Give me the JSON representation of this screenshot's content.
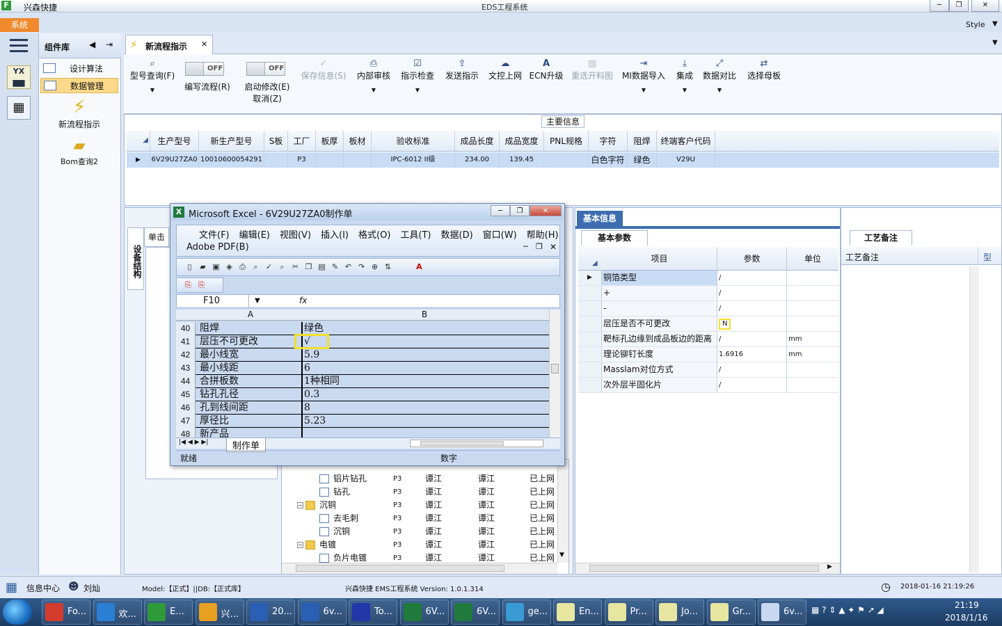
{
  "window": {
    "app_name": "兴森快捷",
    "title": "EDS工程系统",
    "style_label": "Style"
  },
  "system_menu": "系统",
  "component_library": {
    "title": "组件库",
    "items": [
      {
        "label": "设计算法"
      },
      {
        "label": "数据管理",
        "selected": true
      }
    ],
    "tools": [
      {
        "label": "新流程指示"
      },
      {
        "label": "Bom查询2"
      }
    ]
  },
  "doc_tab": {
    "label": "新流程指示"
  },
  "ribbon": {
    "buttons": [
      {
        "label": "型号查询(F)",
        "icon": "search-icon",
        "disabled": false
      },
      {
        "label": "保存信息(S)",
        "icon": "check-icon",
        "disabled": true
      },
      {
        "label": "内部审核",
        "icon": "printer-icon",
        "disabled": false
      },
      {
        "label": "指示检查",
        "icon": "checkbox-icon",
        "disabled": false
      },
      {
        "label": "发送指示",
        "icon": "upload-icon",
        "disabled": false
      },
      {
        "label": "文控上网",
        "icon": "cloud-upload-icon",
        "disabled": false
      },
      {
        "label": "ECN升级",
        "icon": "letter-a-icon",
        "disabled": false
      },
      {
        "label": "重选开料图",
        "icon": "image-icon",
        "disabled": true
      },
      {
        "label": "MI数据导入",
        "icon": "import-icon",
        "disabled": false
      },
      {
        "label": "集成",
        "icon": "download-icon",
        "disabled": false
      },
      {
        "label": "数据对比",
        "icon": "compare-icon",
        "disabled": false
      },
      {
        "label": "选择母板",
        "icon": "shuffle-icon",
        "disabled": false
      }
    ],
    "toggles": [
      {
        "state": "OFF",
        "label": "编写流程(R)"
      },
      {
        "state": "OFF",
        "label": "启动修改(E)",
        "sub_label": "取消(Z)"
      }
    ]
  },
  "main_info": {
    "title": "主要信息",
    "columns": [
      "生产型号",
      "新生产型号",
      "S板",
      "工厂",
      "板厚",
      "板材",
      "验收标准",
      "成品长度",
      "成品宽度",
      "PNL规格",
      "字符",
      "阻焊",
      "终端客户代码"
    ],
    "rows": [
      [
        "6V29U27ZA0",
        "10010600054291",
        "",
        "P3",
        "",
        "",
        "IPC-6012 II级",
        "234.00",
        "139.45",
        "",
        "白色字符",
        "绿色",
        "V29U"
      ]
    ]
  },
  "left_panel": {
    "vertical_tab": "设备结构",
    "tab_label": "单击"
  },
  "tree": {
    "rows": [
      {
        "label": "铝片钻孔",
        "level": 2,
        "type": "doc",
        "c1": "P3",
        "c2": "谭江",
        "c3": "谭江",
        "c4": "已上网"
      },
      {
        "label": "钻孔",
        "level": 2,
        "type": "doc",
        "c1": "P3",
        "c2": "谭江",
        "c3": "谭江",
        "c4": "已上网"
      },
      {
        "label": "沉铜",
        "level": 1,
        "type": "folder",
        "c1": "P3",
        "c2": "谭江",
        "c3": "谭江",
        "c4": "已上网"
      },
      {
        "label": "去毛刺",
        "level": 2,
        "type": "doc",
        "c1": "P3",
        "c2": "谭江",
        "c3": "谭江",
        "c4": "已上网"
      },
      {
        "label": "沉铜",
        "level": 2,
        "type": "doc",
        "c1": "P3",
        "c2": "谭江",
        "c3": "谭江",
        "c4": "已上网"
      },
      {
        "label": "电镀",
        "level": 1,
        "type": "folder",
        "c1": "P3",
        "c2": "谭江",
        "c3": "谭江",
        "c4": "已上网"
      },
      {
        "label": "负片电镀",
        "level": 2,
        "type": "doc",
        "c1": "P3",
        "c2": "谭江",
        "c3": "谭江",
        "c4": "已上网"
      }
    ]
  },
  "basic_info": {
    "tab": "基本信息",
    "subtab": "基本参数",
    "columns": [
      "项目",
      "参数",
      "单位"
    ],
    "rows": [
      {
        "item": "铜箔类型",
        "param": "/",
        "unit": ""
      },
      {
        "item": "+",
        "param": "/",
        "unit": ""
      },
      {
        "item": "-",
        "param": "/",
        "unit": ""
      },
      {
        "item": "层压是否不可更改",
        "param": "N",
        "unit": ""
      },
      {
        "item": "靶标孔边缘到成品板边的距离",
        "param": "/",
        "unit": "mm"
      },
      {
        "item": "理论铆钉长度",
        "param": "1.6916",
        "unit": "mm"
      },
      {
        "item": "Masslam对位方式",
        "param": "/",
        "unit": ""
      },
      {
        "item": "次外层半固化片",
        "param": "/",
        "unit": ""
      }
    ]
  },
  "craft_notes": {
    "tab": "工艺备注",
    "header": "工艺备注",
    "col2": "型"
  },
  "excel": {
    "title": "Microsoft Excel - 6V29U27ZA0制作单",
    "menu": [
      "文件(F)",
      "编辑(E)",
      "视图(V)",
      "插入(I)",
      "格式(O)",
      "工具(T)",
      "数据(D)",
      "窗口(W)",
      "帮助(H)"
    ],
    "menu2": "Adobe PDF(B)",
    "name_box": "F10",
    "fx": "fx",
    "col_a": "A",
    "col_b": "B",
    "rows": [
      {
        "n": "40",
        "a": "阻焊",
        "b": "绿色"
      },
      {
        "n": "41",
        "a": "层压不可更改",
        "b": "√"
      },
      {
        "n": "42",
        "a": "最小线宽",
        "b": "5.9"
      },
      {
        "n": "43",
        "a": "最小线距",
        "b": "6"
      },
      {
        "n": "44",
        "a": "合拼板数",
        "b": "1种相同"
      },
      {
        "n": "45",
        "a": "钻孔孔径",
        "b": "0.3"
      },
      {
        "n": "46",
        "a": "孔到线间距",
        "b": "8"
      },
      {
        "n": "47",
        "a": "厚径比",
        "b": "5.23"
      },
      {
        "n": "48",
        "a": "新产品",
        "b": ""
      }
    ],
    "sheet_tab": "制作单",
    "status_ready": "就绪",
    "status_num": "数字"
  },
  "statusbar": {
    "info_center": "信息中心",
    "user": "刘灿",
    "model_db": "Model:【正式】||DB:【正式库】",
    "system_version": "兴森快捷 EMS工程系统 Version: 1.0.1.314",
    "datetime": "2018-01-16 21:19:26"
  },
  "taskbar": {
    "apps": [
      {
        "label": "Fo...",
        "color": "#d33b2c"
      },
      {
        "label": "欢...",
        "color": "#2a7fd4"
      },
      {
        "label": "E...",
        "color": "#2f9a3a"
      },
      {
        "label": "兴...",
        "color": "#e8a020"
      },
      {
        "label": "20...",
        "color": "#2b5fb3"
      },
      {
        "label": "6v...",
        "color": "#2b5fb3"
      },
      {
        "label": "To...",
        "color": "#2236a8"
      },
      {
        "label": "6V...",
        "color": "#1f7a3c"
      },
      {
        "label": "6V...",
        "color": "#1f7a3c"
      },
      {
        "label": "ge...",
        "color": "#3a9bd4"
      },
      {
        "label": "En...",
        "color": "#e6e6a0"
      },
      {
        "label": "Pr...",
        "color": "#e6e6a0"
      },
      {
        "label": "Jo...",
        "color": "#e6e6a0"
      },
      {
        "label": "Gr...",
        "color": "#e6e6a0"
      },
      {
        "label": "6v...",
        "color": "#c8d8f0"
      }
    ],
    "time": "21:19",
    "date": "2018/1/16"
  }
}
